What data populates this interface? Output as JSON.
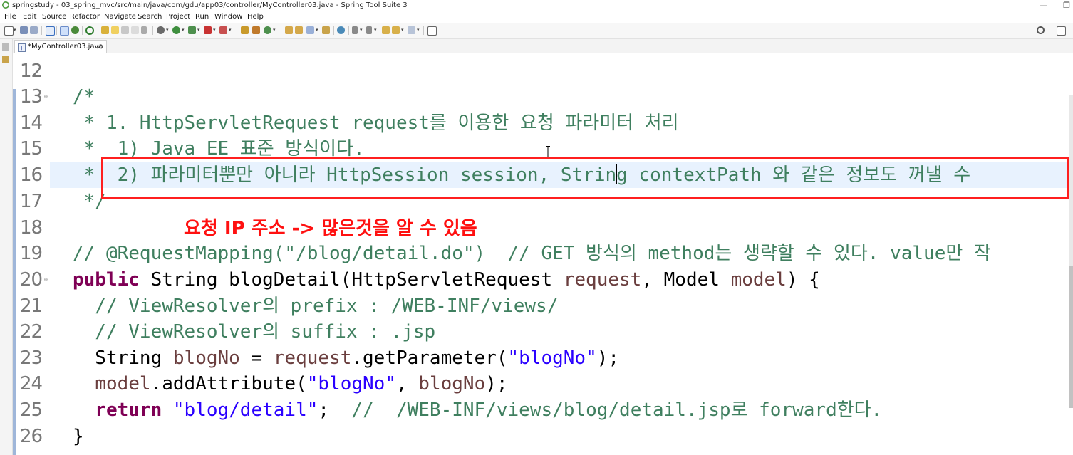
{
  "window": {
    "title": "springstudy - 03_spring_mvc/src/main/java/com/gdu/app03/controller/MyController03.java - Spring Tool Suite 3",
    "minimize_glyph": "—",
    "restore_glyph": "❐"
  },
  "menu": [
    "File",
    "Edit",
    "Source",
    "Refactor",
    "Navigate",
    "Search",
    "Project",
    "Run",
    "Window",
    "Help"
  ],
  "toolbar": {
    "accent_colors": [
      "#4a8a3a",
      "#d08a22",
      "#3a6fbf",
      "#c83232"
    ]
  },
  "editor_tab": {
    "label": "*MyController03.java",
    "icon_letter": "J",
    "close_glyph": "×"
  },
  "editor": {
    "partial_top_line": "   ⁠      ⁠    {",
    "lines": [
      {
        "num": "12",
        "code": ""
      },
      {
        "num": "13",
        "code": "/*"
      },
      {
        "num": "14",
        "code": " * 1. HttpServletRequest request를 이용한 요청 파라미터 처리"
      },
      {
        "num": "15",
        "code": " *  1) Java EE 표준 방식이다."
      },
      {
        "num": "16",
        "code_before_caret": " *  2) 파라미터뿐만 아니라 HttpSession session, Strin",
        "code_after_caret": "g contextPath 와 같은 정보도 꺼낼 수"
      },
      {
        "num": "17",
        "code": " */"
      },
      {
        "num": "18",
        "code": ""
      },
      {
        "num": "19",
        "code": "// @RequestMapping(\"/blog/detail.do\")  // GET 방식의 method는 생략할 수 있다. value만 작"
      },
      {
        "num": "20",
        "kw1": "public",
        "t1": " String blogDetail(HttpServletRequest ",
        "v1": "request",
        "t2": ", Model ",
        "v2": "model",
        "t3": ") {"
      },
      {
        "num": "21",
        "code": "  // ViewResolver의 prefix : /WEB-INF/views/"
      },
      {
        "num": "22",
        "code": "  // ViewResolver의 suffix : .jsp"
      },
      {
        "num": "23",
        "t1": "  String ",
        "v1": "blogNo",
        "t2": " = ",
        "v2": "request",
        "t3": ".getParameter(",
        "s1": "\"blogNo\"",
        "t4": ");"
      },
      {
        "num": "24",
        "t1": "  ",
        "v1": "model",
        "t2": ".addAttribute(",
        "s1": "\"blogNo\"",
        "t3": ", ",
        "v2": "blogNo",
        "t4": ");"
      },
      {
        "num": "25",
        "kw1": "  return",
        "t1": " ",
        "s1": "\"blog/detail\"",
        "t2": ";  ",
        "c1": "//  /WEB-INF/views/blog/detail.jsp로 forward한다."
      },
      {
        "num": "26",
        "code": "}"
      }
    ]
  },
  "annotation": {
    "text": "요청 IP 주소 -> 많은것을 알 수 있음",
    "color": "#ff1010"
  }
}
